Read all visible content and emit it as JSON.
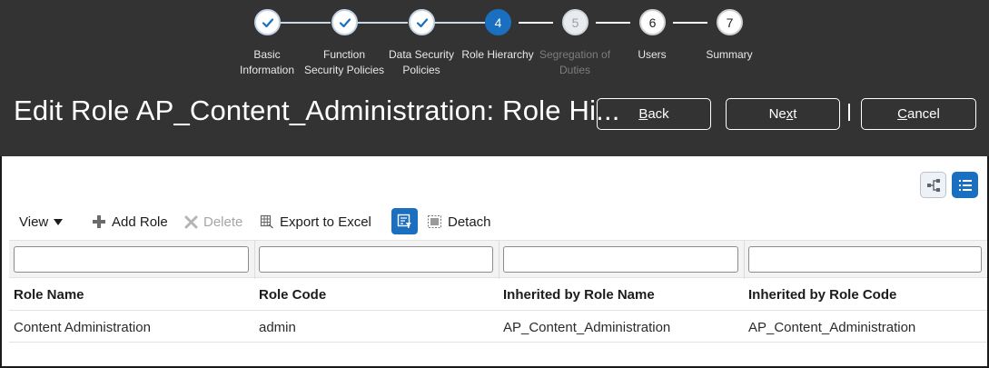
{
  "train": {
    "steps": [
      {
        "number": "",
        "label_lines": [
          "Basic",
          "Information"
        ],
        "status": "done",
        "icon": "checkmark-icon"
      },
      {
        "number": "",
        "label_lines": [
          "Function",
          "Security Policies"
        ],
        "status": "done",
        "icon": "checkmark-icon"
      },
      {
        "number": "",
        "label_lines": [
          "Data Security",
          "Policies"
        ],
        "status": "done",
        "icon": "checkmark-icon"
      },
      {
        "number": "4",
        "label_lines": [
          "Role Hierarchy",
          ""
        ],
        "status": "current"
      },
      {
        "number": "5",
        "label_lines": [
          "Segregation of",
          "Duties"
        ],
        "status": "disabled"
      },
      {
        "number": "6",
        "label_lines": [
          "Users",
          ""
        ],
        "status": "todo"
      },
      {
        "number": "7",
        "label_lines": [
          "Summary",
          ""
        ],
        "status": "todo"
      }
    ]
  },
  "header": {
    "title": "Edit Role AP_Content_Administration: Role Hi...",
    "buttons": {
      "back": {
        "pre": "",
        "accel": "B",
        "post": "ack"
      },
      "next": {
        "pre": "Ne",
        "accel": "x",
        "post": "t"
      },
      "cancel": {
        "pre": "",
        "accel": "C",
        "post": "ancel"
      }
    }
  },
  "view_toggles": {
    "hierarchy_icon": "hierarchy-view-icon",
    "list_icon": "list-view-icon",
    "active": "list"
  },
  "toolbar": {
    "view_label": "View",
    "add_role_label": "Add Role",
    "delete_label": "Delete",
    "export_label": "Export to Excel",
    "detach_label": "Detach"
  },
  "table": {
    "filters": [
      "",
      "",
      "",
      ""
    ],
    "columns": [
      "Role Name",
      "Role Code",
      "Inherited by Role Name",
      "Inherited by Role Code"
    ],
    "rows": [
      [
        "Content Administration",
        "admin",
        "AP_Content_Administration",
        "AP_Content_Administration"
      ]
    ]
  },
  "colors": {
    "header_bg": "#333333",
    "accent": "#1b6fc0"
  }
}
